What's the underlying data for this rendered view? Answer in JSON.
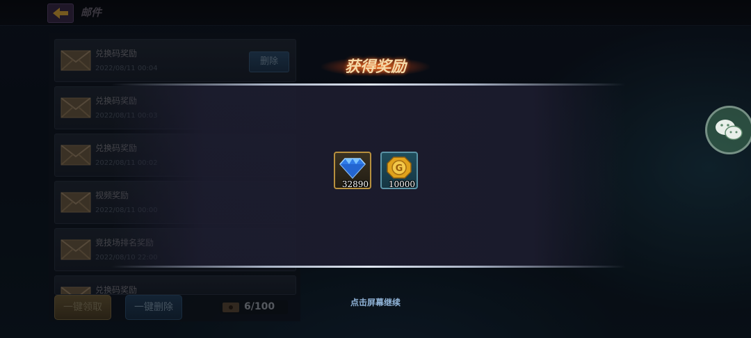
{
  "header": {
    "title": "邮件",
    "back_icon": "back-arrow-icon"
  },
  "mail_list": {
    "items": [
      {
        "title": "兑换码奖励",
        "date": "2022/08/11 00:04",
        "delete_label": "删除",
        "icon": "envelope-icon"
      },
      {
        "title": "兑换码奖励",
        "date": "2022/08/11 00:03",
        "icon": "envelope-icon"
      },
      {
        "title": "兑换码奖励",
        "date": "2022/08/11 00:02",
        "icon": "envelope-icon"
      },
      {
        "title": "视频奖励",
        "date": "2022/08/11 00:00",
        "icon": "envelope-icon"
      },
      {
        "title": "竞技场排名奖励",
        "date": "2022/08/10 22:00",
        "icon": "envelope-icon"
      },
      {
        "title": "兑换码奖励",
        "date": "",
        "icon": "envelope-icon"
      }
    ]
  },
  "footer": {
    "claim_all_label": "一键领取",
    "delete_all_label": "一键删除",
    "capacity": "6/100"
  },
  "reward_modal": {
    "title": "获得奖励",
    "rewards": [
      {
        "icon": "diamond-icon",
        "count": "32890"
      },
      {
        "icon": "gold-coin-icon",
        "count": "10000"
      }
    ],
    "continue_hint": "点击屏幕继续"
  },
  "share": {
    "icon": "wechat-icon"
  },
  "colors": {
    "accent_orange": "#ff7a28",
    "title_gold": "#f4d9a8",
    "hint_blue": "#8fb2d6"
  }
}
